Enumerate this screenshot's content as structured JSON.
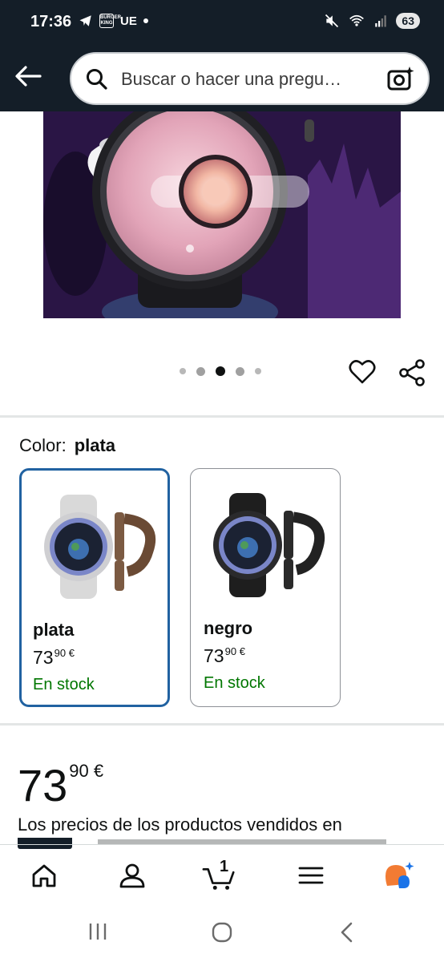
{
  "status_bar": {
    "time": "17:36",
    "carrier_box": "BURGER KING",
    "carrier": "UE",
    "battery": "63"
  },
  "search": {
    "placeholder": "Buscar o hacer una pregu…"
  },
  "carousel": {
    "dots": 5,
    "active_index": 2
  },
  "color_section": {
    "label": "Color:",
    "selected": "plata",
    "options": [
      {
        "name": "plata",
        "price_whole": "73",
        "price_fraction": "90",
        "currency": "€",
        "stock": "En stock",
        "selected": true
      },
      {
        "name": "negro",
        "price_whole": "73",
        "price_fraction": "90",
        "currency": "€",
        "stock": "En stock",
        "selected": false
      }
    ]
  },
  "main_price": {
    "whole": "73",
    "fraction": "90",
    "currency": "€"
  },
  "price_note": "Los precios de los productos vendidos en",
  "bottom_nav": {
    "items": [
      "home-icon",
      "account-icon",
      "cart-icon",
      "menu-icon",
      "rufus-icon"
    ],
    "cart_count": "1"
  },
  "colors": {
    "header_bg": "#141e28",
    "selected_border": "#2162a1",
    "stock_green": "#007600"
  }
}
